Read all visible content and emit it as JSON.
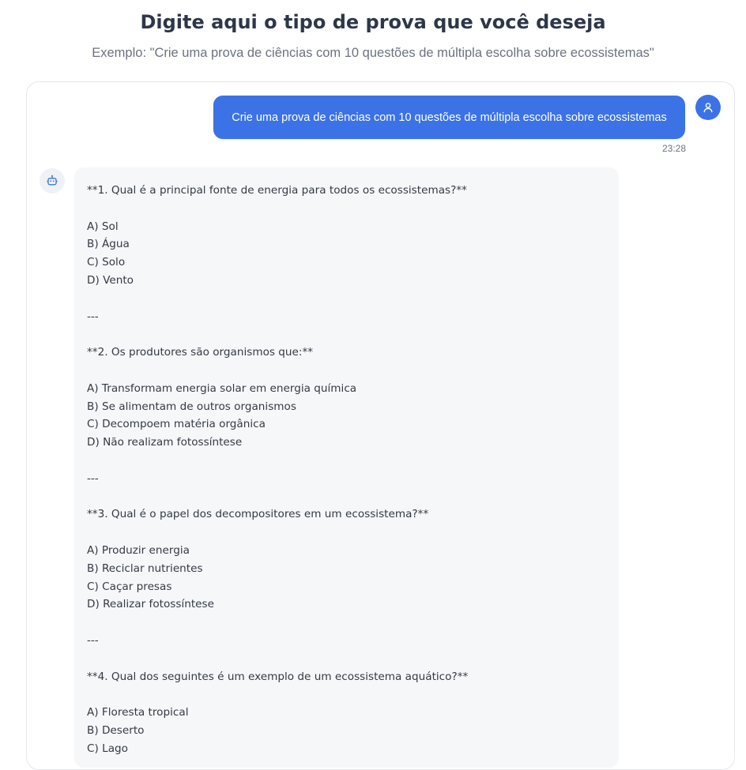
{
  "header": {
    "title": "Digite aqui o tipo de prova que você deseja",
    "subtitle": "Exemplo: \"Crie uma prova de ciências com 10 questões de múltipla escolha sobre ecossistemas\""
  },
  "chat": {
    "user_message": {
      "text": "Crie uma prova de ciências com 10 questões de múltipla escolha sobre ecossistemas",
      "time": "23:28",
      "avatar_icon": "user-icon"
    },
    "bot_message": {
      "avatar_icon": "robot-icon",
      "lines": [
        "**1. Qual é a principal fonte de energia para todos os ecossistemas?**",
        "",
        "A) Sol",
        "B) Água",
        "C) Solo",
        "D) Vento",
        "",
        "---",
        "",
        "**2. Os produtores são organismos que:**",
        "",
        "A) Transformam energia solar em energia química",
        "B) Se alimentam de outros organismos",
        "C) Decompoem matéria orgânica",
        "D) Não realizam fotossíntese",
        "",
        "---",
        "",
        "**3. Qual é o papel dos decompositores em um ecossistema?**",
        "",
        "A) Produzir energia",
        "B) Reciclar nutrientes",
        "C) Caçar presas",
        "D) Realizar fotossíntese",
        "",
        "---",
        "",
        "**4. Qual dos seguintes é um exemplo de um ecossistema aquático?**",
        "",
        "A) Floresta tropical",
        "B) Deserto",
        "C) Lago"
      ]
    }
  },
  "colors": {
    "accent": "#3b72e6",
    "bot_bubble": "#f6f7f9",
    "text": "#333a44"
  }
}
